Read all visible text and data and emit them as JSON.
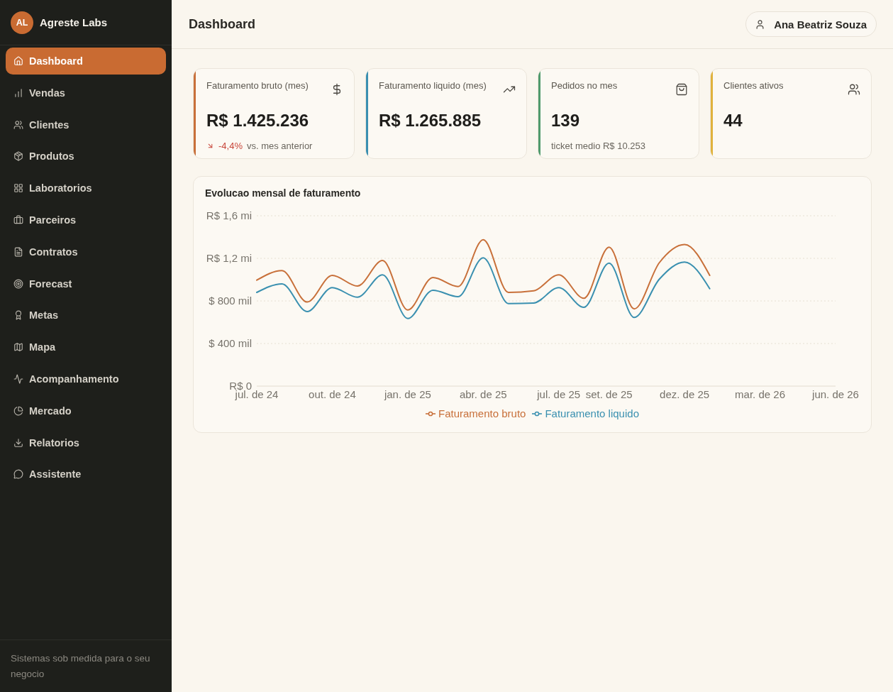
{
  "sidebar": {
    "brand": {
      "initials": "AL",
      "name": "Agreste Labs"
    },
    "items": [
      {
        "label": "Dashboard",
        "selected": true
      },
      {
        "label": "Vendas",
        "selected": false
      },
      {
        "label": "Clientes",
        "selected": false
      },
      {
        "label": "Produtos",
        "selected": false
      },
      {
        "label": "Laboratorios",
        "selected": false
      },
      {
        "label": "Parceiros",
        "selected": false
      },
      {
        "label": "Contratos",
        "selected": false
      },
      {
        "label": "Forecast",
        "selected": false
      },
      {
        "label": "Metas",
        "selected": false
      },
      {
        "label": "Mapa",
        "selected": false
      },
      {
        "label": "Acompanhamento",
        "selected": false
      },
      {
        "label": "Mercado",
        "selected": false
      },
      {
        "label": "Relatorios",
        "selected": false
      },
      {
        "label": "Assistente",
        "selected": false
      }
    ],
    "footer": "Sistemas sob medida para o seu negocio"
  },
  "header": {
    "title": "Dashboard",
    "user": "Ana Beatriz Souza"
  },
  "cards": [
    {
      "title": "Faturamento bruto (mes)",
      "value": "R$ 1.425.236",
      "color": "#c8703a",
      "delta": {
        "value": "-4,4%",
        "negative": true
      },
      "note": "vs. mes anterior"
    },
    {
      "title": "Faturamento liquido (mes)",
      "value": "R$ 1.265.885",
      "color": "#3a8fb0"
    },
    {
      "title": "Pedidos no mes",
      "value": "139",
      "color": "#4f9a6c",
      "note": "ticket medio R$ 10.253"
    },
    {
      "title": "Clientes ativos",
      "value": "44",
      "color": "#e0b23c"
    }
  ],
  "chart": {
    "title": "Evolucao mensal de faturamento",
    "chart_data": {
      "type": "line",
      "grid": true,
      "categories": [
        "jul. de 24",
        null,
        null,
        "out. de 24",
        null,
        null,
        "jan. de 25",
        null,
        null,
        "abr. de 25",
        null,
        null,
        "jul. de 25",
        null,
        "set. de 25",
        null,
        null,
        "dez. de 25",
        null,
        null,
        "mar. de 26",
        null,
        null,
        "jun. de 26"
      ],
      "ylim": [
        0,
        1600
      ],
      "yticks": [
        {
          "value": 0,
          "label": "R$ 0"
        },
        {
          "value": 400,
          "label": "$ 400 mil"
        },
        {
          "value": 800,
          "label": "$ 800 mil"
        },
        {
          "value": 1200,
          "label": "R$ 1,2 mi"
        },
        {
          "value": 1600,
          "label": "R$ 1,6 mi"
        }
      ],
      "series": [
        {
          "name": "Faturamento bruto",
          "color": "#c8703a",
          "values": [
            995,
            1085,
            790,
            1040,
            940,
            1180,
            715,
            1020,
            935,
            1375,
            880,
            895,
            1045,
            825,
            1305,
            725,
            1160,
            1330,
            1040,
            null,
            null,
            null,
            null,
            null
          ]
        },
        {
          "name": "Faturamento liquido",
          "color": "#3a90b0",
          "values": [
            880,
            960,
            700,
            925,
            835,
            1045,
            635,
            900,
            840,
            1205,
            775,
            780,
            925,
            740,
            1155,
            645,
            1005,
            1165,
            915,
            null,
            null,
            null,
            null,
            null
          ]
        }
      ]
    }
  }
}
